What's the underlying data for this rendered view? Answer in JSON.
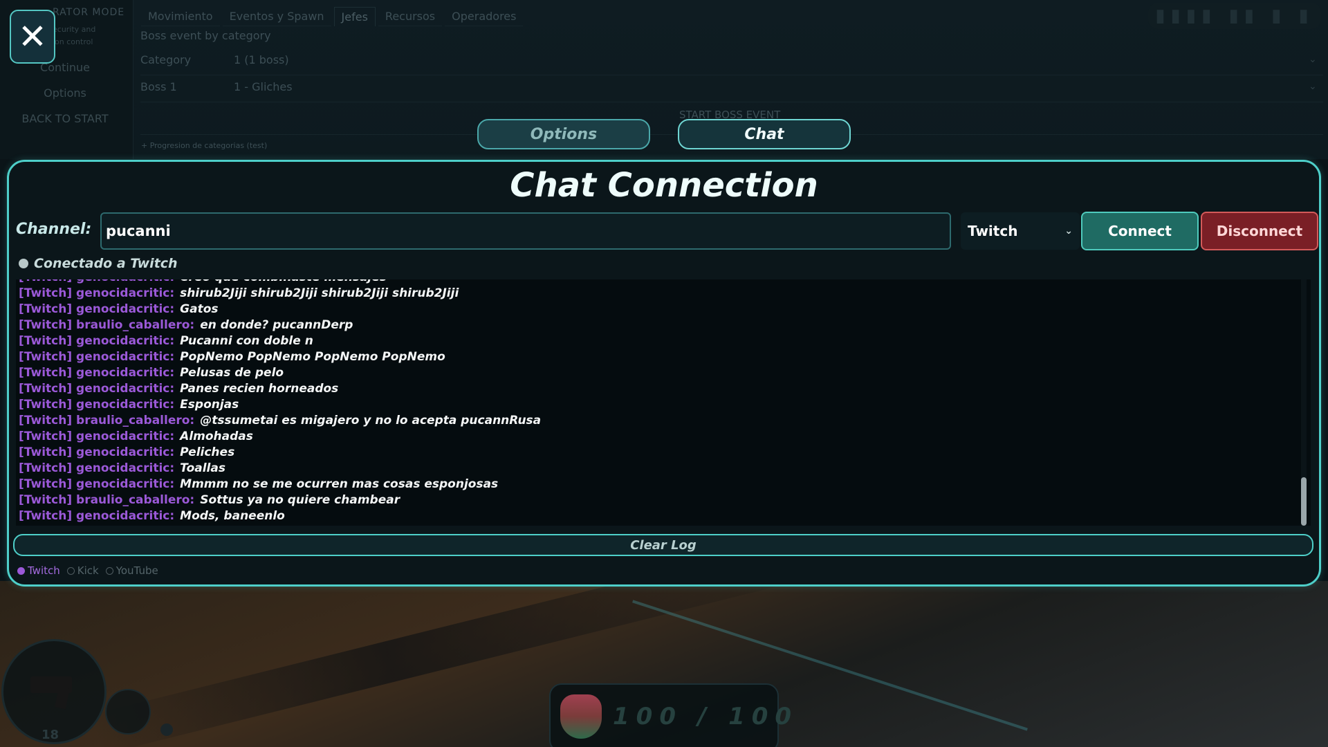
{
  "pause_menu": {
    "mode_title": "RATOR MODE",
    "subtitle": "ecurity and\nion control",
    "items": [
      "Continue",
      "Options",
      "BACK TO START"
    ]
  },
  "operator": {
    "tabs": [
      "Movimiento",
      "Eventos y Spawn",
      "Jefes",
      "Recursos",
      "Operadores"
    ],
    "active_tab": "Jefes",
    "section_title": "Boss event by category",
    "category_label": "Category",
    "category_value": "1 (1 boss)",
    "boss_label": "Boss 1",
    "boss_value": "1 - Gliches",
    "start_button": "START BOSS EVENT",
    "footnote": "+ Progresion de categorias (test)"
  },
  "top_nav": {
    "options_label": "Options",
    "chat_label": "Chat"
  },
  "chat_panel": {
    "title": "Chat Connection",
    "channel_label": "Channel:",
    "channel_value": "pucanni",
    "platform_selected": "Twitch",
    "connect_label": "Connect",
    "disconnect_label": "Disconnect",
    "status_text": "Conectado a Twitch",
    "clear_label": "Clear Log",
    "messages": [
      {
        "user": "[Twitch] genocidacritic:",
        "text": "Creo que combinaste mensajes"
      },
      {
        "user": "[Twitch] genocidacritic:",
        "text": "shirub2Jiji shirub2Jiji shirub2Jiji shirub2Jiji"
      },
      {
        "user": "[Twitch] genocidacritic:",
        "text": "Gatos"
      },
      {
        "user": "[Twitch] braulio_caballero:",
        "text": "en donde? pucannDerp"
      },
      {
        "user": "[Twitch] genocidacritic:",
        "text": "Pucanni con doble n"
      },
      {
        "user": "[Twitch] genocidacritic:",
        "text": "PopNemo PopNemo PopNemo PopNemo"
      },
      {
        "user": "[Twitch] genocidacritic:",
        "text": "Pelusas de pelo"
      },
      {
        "user": "[Twitch] genocidacritic:",
        "text": "Panes recien horneados"
      },
      {
        "user": "[Twitch] genocidacritic:",
        "text": "Esponjas"
      },
      {
        "user": "[Twitch] braulio_caballero:",
        "text": "@tssumetai es migajero y no lo acepta pucannRusa"
      },
      {
        "user": "[Twitch] genocidacritic:",
        "text": "Almohadas"
      },
      {
        "user": "[Twitch] genocidacritic:",
        "text": "Peliches"
      },
      {
        "user": "[Twitch] genocidacritic:",
        "text": "Toallas"
      },
      {
        "user": "[Twitch] genocidacritic:",
        "text": "Mmmm no se me ocurren mas cosas esponjosas"
      },
      {
        "user": "[Twitch] braulio_caballero:",
        "text": "Sottus ya no quiere chambear"
      },
      {
        "user": "[Twitch] genocidacritic:",
        "text": "Mods, baneenlo"
      }
    ],
    "platforms": [
      {
        "label": "Twitch",
        "selected": true
      },
      {
        "label": "Kick",
        "selected": false
      },
      {
        "label": "YouTube",
        "selected": false
      }
    ]
  },
  "hud": {
    "health_current": "100",
    "health_max": "100",
    "health_text": "100 / 100",
    "ammo": "18"
  },
  "colors": {
    "accent": "#4ecfc9",
    "twitch_purple": "#9b59d8",
    "connect_green": "#1f6b63",
    "disconnect_red": "#7a1f26"
  }
}
